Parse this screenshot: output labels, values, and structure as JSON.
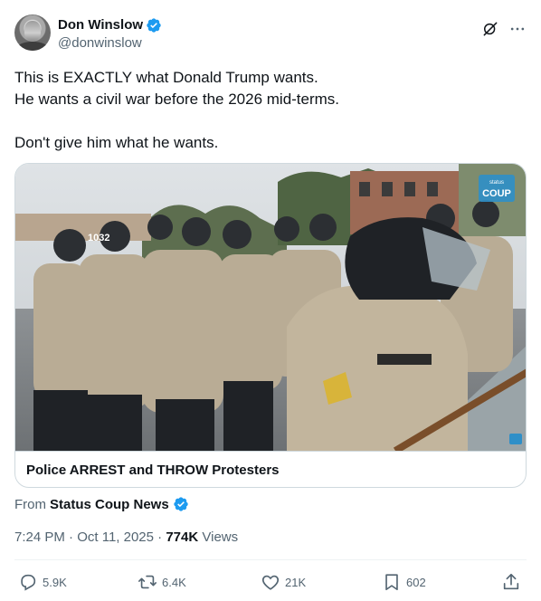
{
  "author": {
    "display_name": "Don Winslow",
    "handle": "@donwinslow",
    "verified": true
  },
  "tweet": {
    "lines": [
      "This is EXACTLY what Donald Trump wants.",
      "He wants a civil war before the 2026 mid-terms.",
      "",
      "Don't give him what he wants."
    ]
  },
  "card": {
    "title": "Police ARREST and THROW Protesters",
    "watermark_line1": "status",
    "watermark_line2": "COUP",
    "media_badge": "1032"
  },
  "source": {
    "prefix": "From",
    "name": "Status Coup News",
    "verified": true
  },
  "meta": {
    "time": "7:24 PM",
    "separator": "·",
    "date": "Oct 11, 2025",
    "separator2": "·",
    "views_count": "774K",
    "views_label": "Views"
  },
  "actions": {
    "replies": "5.9K",
    "reposts": "6.4K",
    "likes": "21K",
    "bookmarks": "602"
  },
  "icons": {
    "verified": "verified-badge-icon",
    "grok": "grok-icon",
    "more": "more-icon",
    "reply": "reply-icon",
    "repost": "repost-icon",
    "like": "heart-icon",
    "bookmark": "bookmark-icon",
    "share": "share-icon"
  },
  "colors": {
    "verified_blue": "#1d9bf0",
    "text_secondary": "#536471",
    "border": "#cfd9de"
  }
}
